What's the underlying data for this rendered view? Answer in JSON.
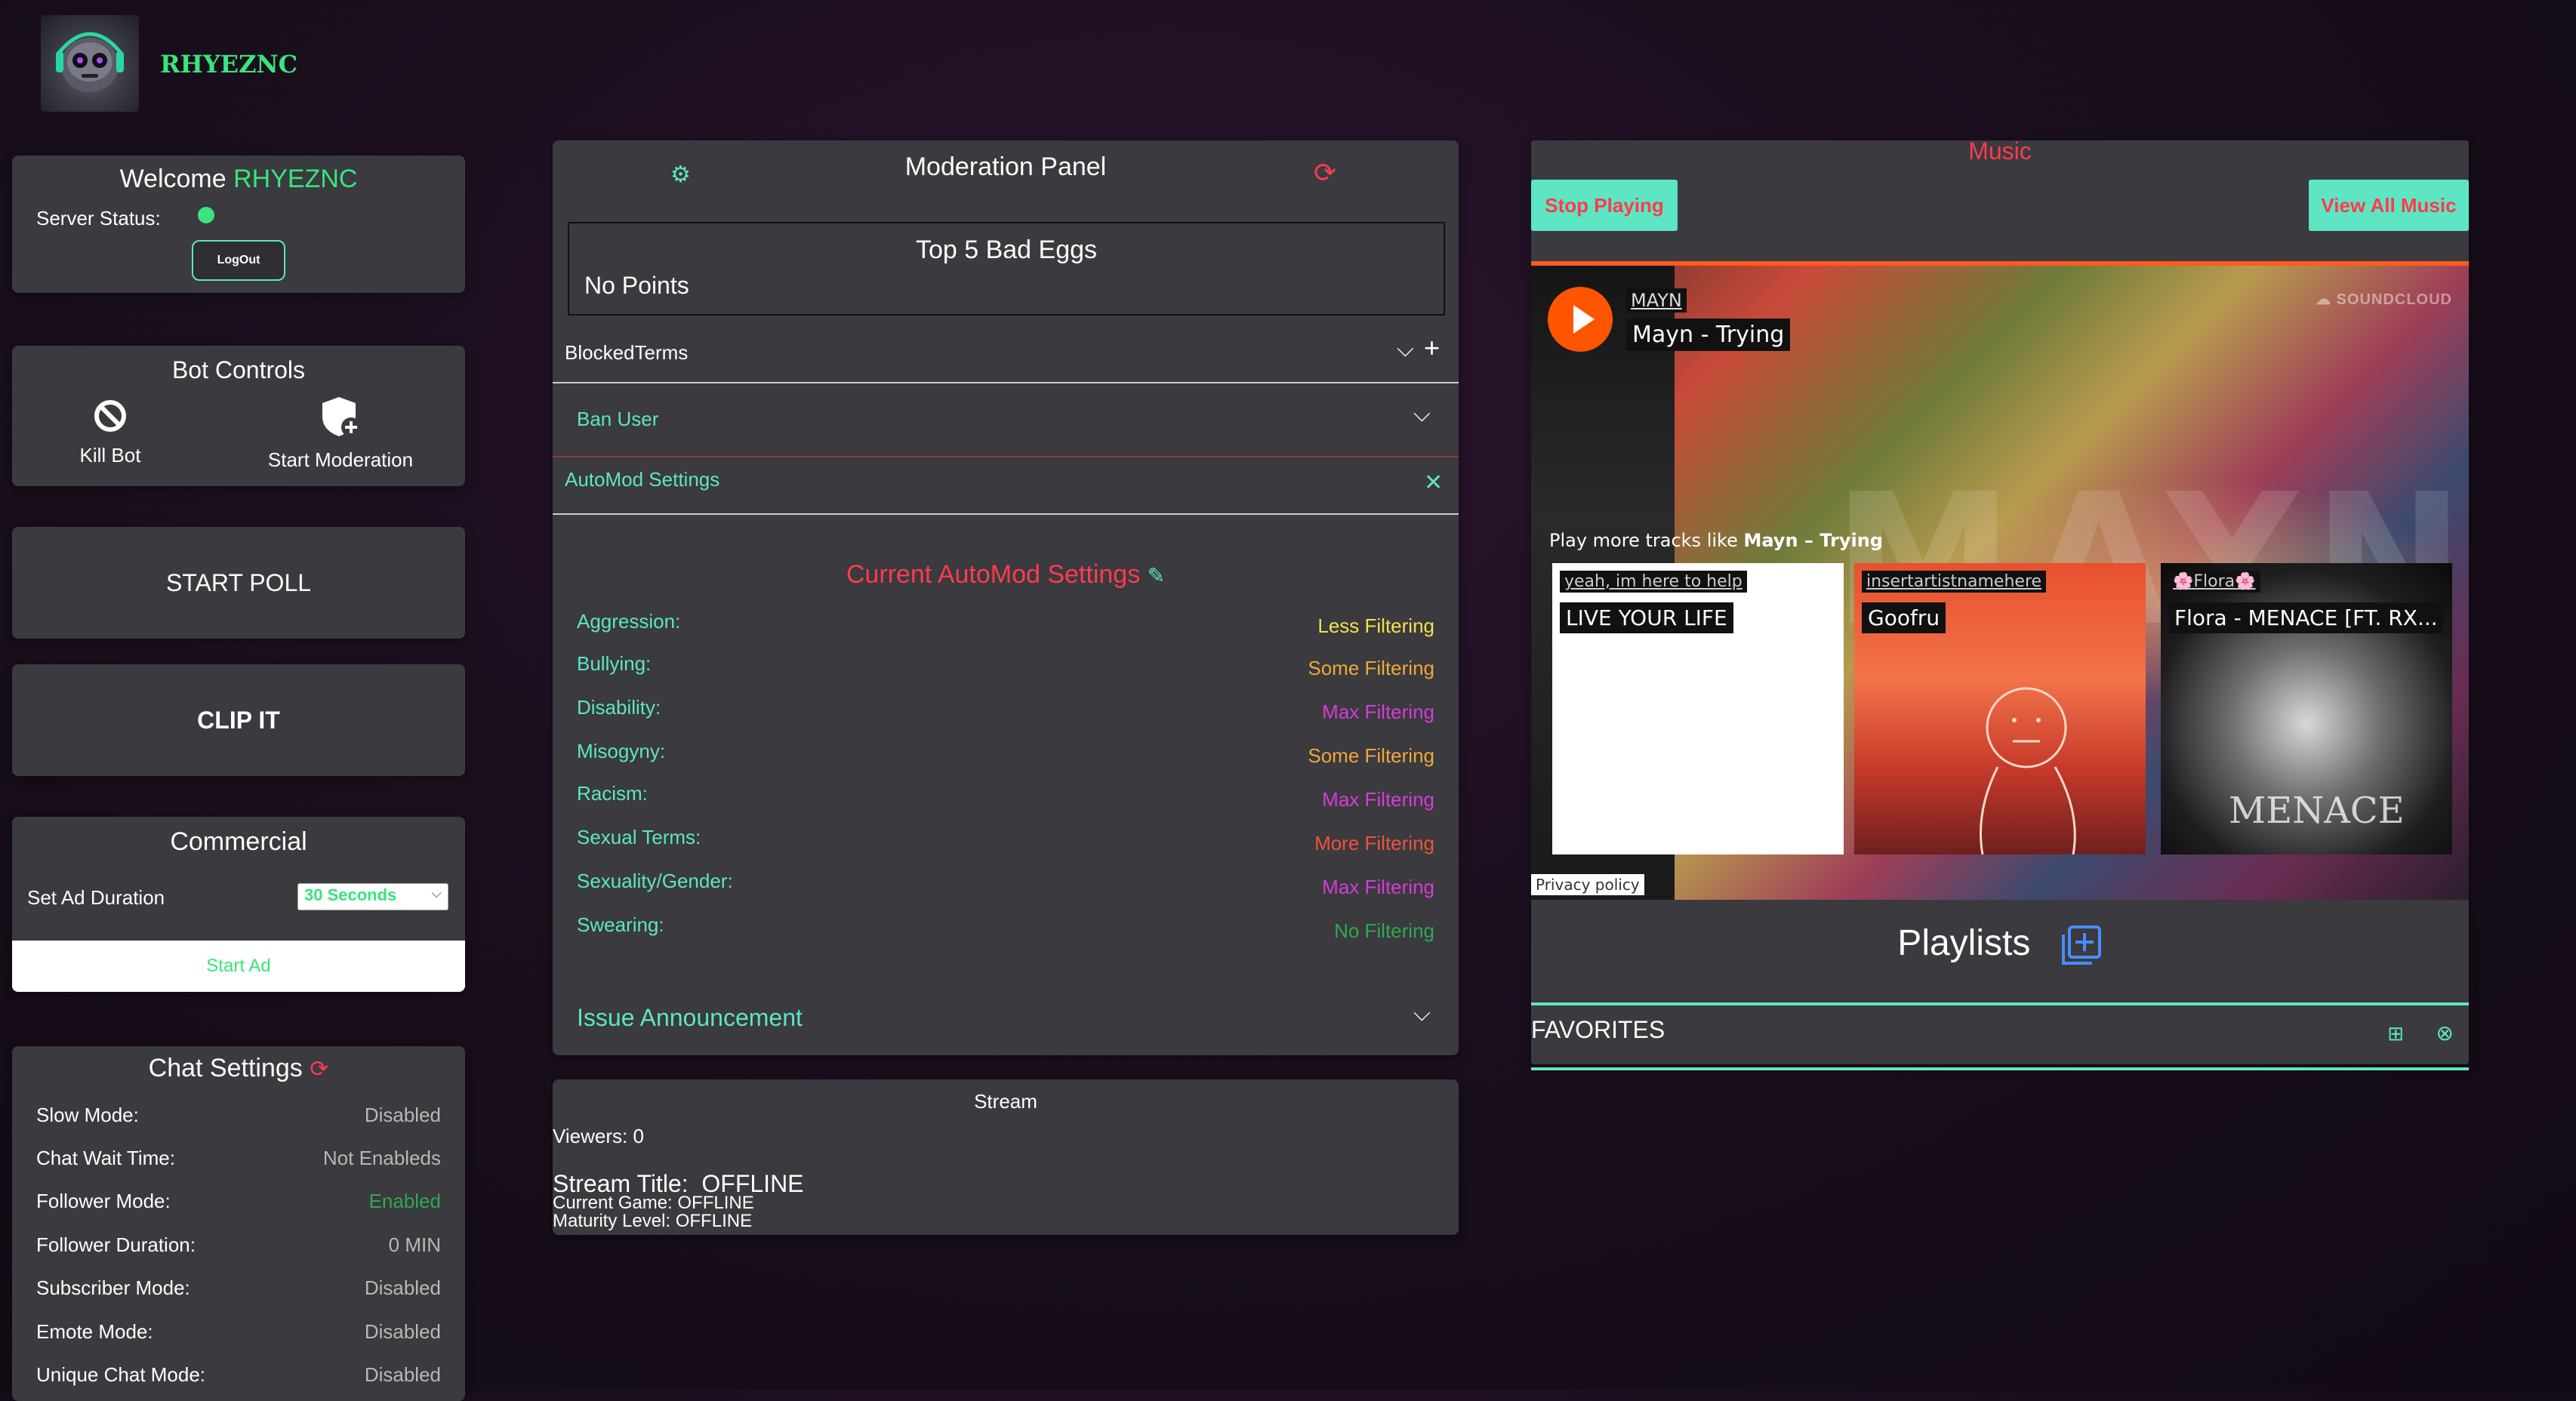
{
  "header": {
    "username": "RHYEZNC"
  },
  "welcome": {
    "prefix": "Welcome ",
    "username": "RHYEZNC",
    "server_status_label": "Server Status:",
    "status_color": "#39e47c",
    "logout_label": "LogOut"
  },
  "bot_controls": {
    "title": "Bot Controls",
    "kill_label": "Kill Bot",
    "start_label": "Start Moderation"
  },
  "poll": {
    "label": "START POLL"
  },
  "clip": {
    "label": "CLIP IT"
  },
  "commercial": {
    "title": "Commercial",
    "duration_label": "Set Ad Duration",
    "duration_value": "30 Seconds",
    "start_label": "Start Ad"
  },
  "chat_settings": {
    "title": "Chat Settings",
    "rows": [
      {
        "label": "Slow Mode:",
        "value": "Disabled",
        "color": "#b8b8b8"
      },
      {
        "label": "Chat Wait Time:",
        "value": "Not Enableds",
        "color": "#b8b8b8"
      },
      {
        "label": "Follower Mode:",
        "value": "Enabled",
        "color": "#2fa84f"
      },
      {
        "label": "Follower Duration:",
        "value": "0 MIN",
        "color": "#b8b8b8"
      },
      {
        "label": "Subscriber Mode:",
        "value": "Disabled",
        "color": "#b8b8b8"
      },
      {
        "label": "Emote Mode:",
        "value": "Disabled",
        "color": "#b8b8b8"
      },
      {
        "label": "Unique Chat Mode:",
        "value": "Disabled",
        "color": "#b8b8b8"
      }
    ]
  },
  "moderation": {
    "title": "Moderation Panel",
    "bad_eggs_title": "Top 5 Bad Eggs",
    "bad_eggs_empty": "No Points",
    "blocked_terms": "BlockedTerms",
    "ban_user": "Ban User",
    "automod_settings": "AutoMod Settings",
    "current_title": "Current AutoMod Settings",
    "settings": [
      {
        "label": "Aggression:",
        "value": "Less Filtering",
        "color": "#f2e24a"
      },
      {
        "label": "Bullying:",
        "value": "Some Filtering",
        "color": "#f0a838"
      },
      {
        "label": "Disability:",
        "value": "Max Filtering",
        "color": "#d63cd6"
      },
      {
        "label": "Misogyny:",
        "value": "Some Filtering",
        "color": "#f0a838"
      },
      {
        "label": "Racism:",
        "value": "Max Filtering",
        "color": "#d63cd6"
      },
      {
        "label": "Sexual Terms:",
        "value": "More Filtering",
        "color": "#f0513a"
      },
      {
        "label": "Sexuality/Gender:",
        "value": "Max Filtering",
        "color": "#d63cd6"
      },
      {
        "label": "Swearing:",
        "value": "No Filtering",
        "color": "#2fa84f"
      }
    ],
    "issue_announcement": "Issue Announcement"
  },
  "stream": {
    "title": "Stream",
    "viewers": "Viewers: 0",
    "stream_title_label": "Stream Title:",
    "stream_title_value": "OFFLINE",
    "current_game": "Current Game: OFFLINE",
    "maturity": "Maturity Level: OFFLINE"
  },
  "music": {
    "title": "Music",
    "stop_label": "Stop Playing",
    "view_all_label": "View All Music",
    "player": {
      "artist": "MAYN",
      "track": "Mayn - Trying",
      "brand": "SOUNDCLOUD",
      "more_prefix": "Play more tracks like ",
      "more_track": "Mayn – Trying",
      "privacy": "Privacy policy",
      "art_text": "MAYN",
      "tiles": [
        {
          "user": "yeah, im here to help",
          "title": "LIVE YOUR LIFE"
        },
        {
          "user": "insertartistnamehere",
          "title": "Goofru"
        },
        {
          "user": "🌸Flora🌸",
          "title": "Flora - MENACE [FT. RX...",
          "art_text": "MENACE"
        }
      ]
    },
    "playlists_title": "Playlists",
    "favorites_label": "FAVORITES"
  }
}
